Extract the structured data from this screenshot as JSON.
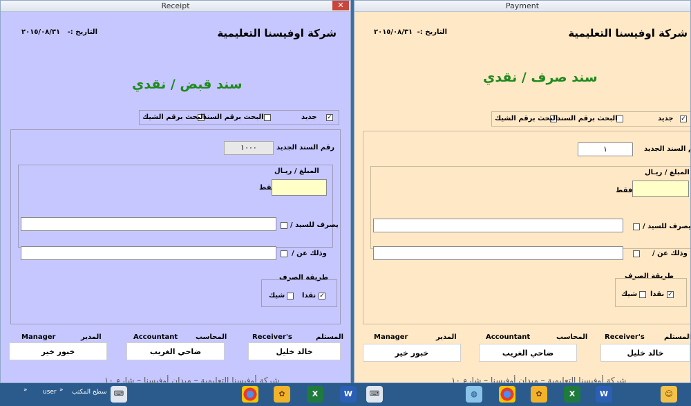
{
  "receipt": {
    "window_title": "Receipt",
    "company": "شركة اوفيسنا التعليمية",
    "date_label": "التاريخ :-",
    "date_value": "٢٠١٥/٠٨/٣١",
    "doc_title": "سند قبض / نقدي",
    "opt_new": "جديد",
    "opt_search_voucher": "البحث برقم السند",
    "opt_search_check": "البحث برقم الشيك",
    "new_voucher_label": "رقم السند الجديد",
    "new_voucher_value": "١٠٠٠",
    "amount_label": "المبلغ / ريـال",
    "only_label": "فقط",
    "amount_value": "",
    "pay_to_label": "يصرف للسيد /",
    "pay_to_value": "",
    "for_label": "وذلك عن /",
    "for_value": "",
    "method_label": "طريقة الصرف",
    "method_cash": "نقدا",
    "method_check": "شيك",
    "receiver_ar": "المستلم",
    "receiver_en": "Receiver's",
    "receiver_name": "خالد خليل",
    "accountant_ar": "المحاسب",
    "accountant_en": "Accountant",
    "accountant_name": "ضاحي الغريب",
    "manager_ar": "المدير",
    "manager_en": "Manager",
    "manager_name": "خبور خير",
    "footer": "شركة أوفيسنا التعليمية – ميدان أوفيسنا – شارع ١٠"
  },
  "payment": {
    "window_title": "Payment",
    "company": "شركة اوفيسنا التعليمية",
    "date_label": "التاريخ :-",
    "date_value": "٢٠١٥/٠٨/٣١",
    "doc_title": "سند صرف / نقدي",
    "opt_new": "جديد",
    "opt_search_voucher": "البحث برقم السند",
    "opt_search_check": "البحث برقم الشيك",
    "new_voucher_label": "رقم السند الجديد",
    "new_voucher_value": "١",
    "amount_label": "المبلغ / ريـال",
    "only_label": "فقط",
    "amount_value": "",
    "pay_to_label": "يصرف للسيد /",
    "pay_to_value": "",
    "for_label": "وذلك عن /",
    "for_value": "",
    "method_label": "طريقة الصرف",
    "method_cash": "نقدا",
    "method_check": "شيك",
    "receiver_ar": "المستلم",
    "receiver_en": "Receiver's",
    "receiver_name": "خالد خليل",
    "accountant_ar": "المحاسب",
    "accountant_en": "Accountant",
    "accountant_name": "ضاحي الغريب",
    "manager_ar": "المدير",
    "manager_en": "Manager",
    "manager_name": "خبور خير",
    "footer": "شركة أوفيسنا التعليمية – ميدان أوفيسنا – شارع ١٠"
  },
  "taskbar": {
    "user": "user",
    "desktop": "سطح المكتب",
    "chevron": "»",
    "icons": [
      "chrome-icon",
      "paint-icon",
      "excel-icon",
      "word-icon",
      "keyboard-icon"
    ]
  }
}
